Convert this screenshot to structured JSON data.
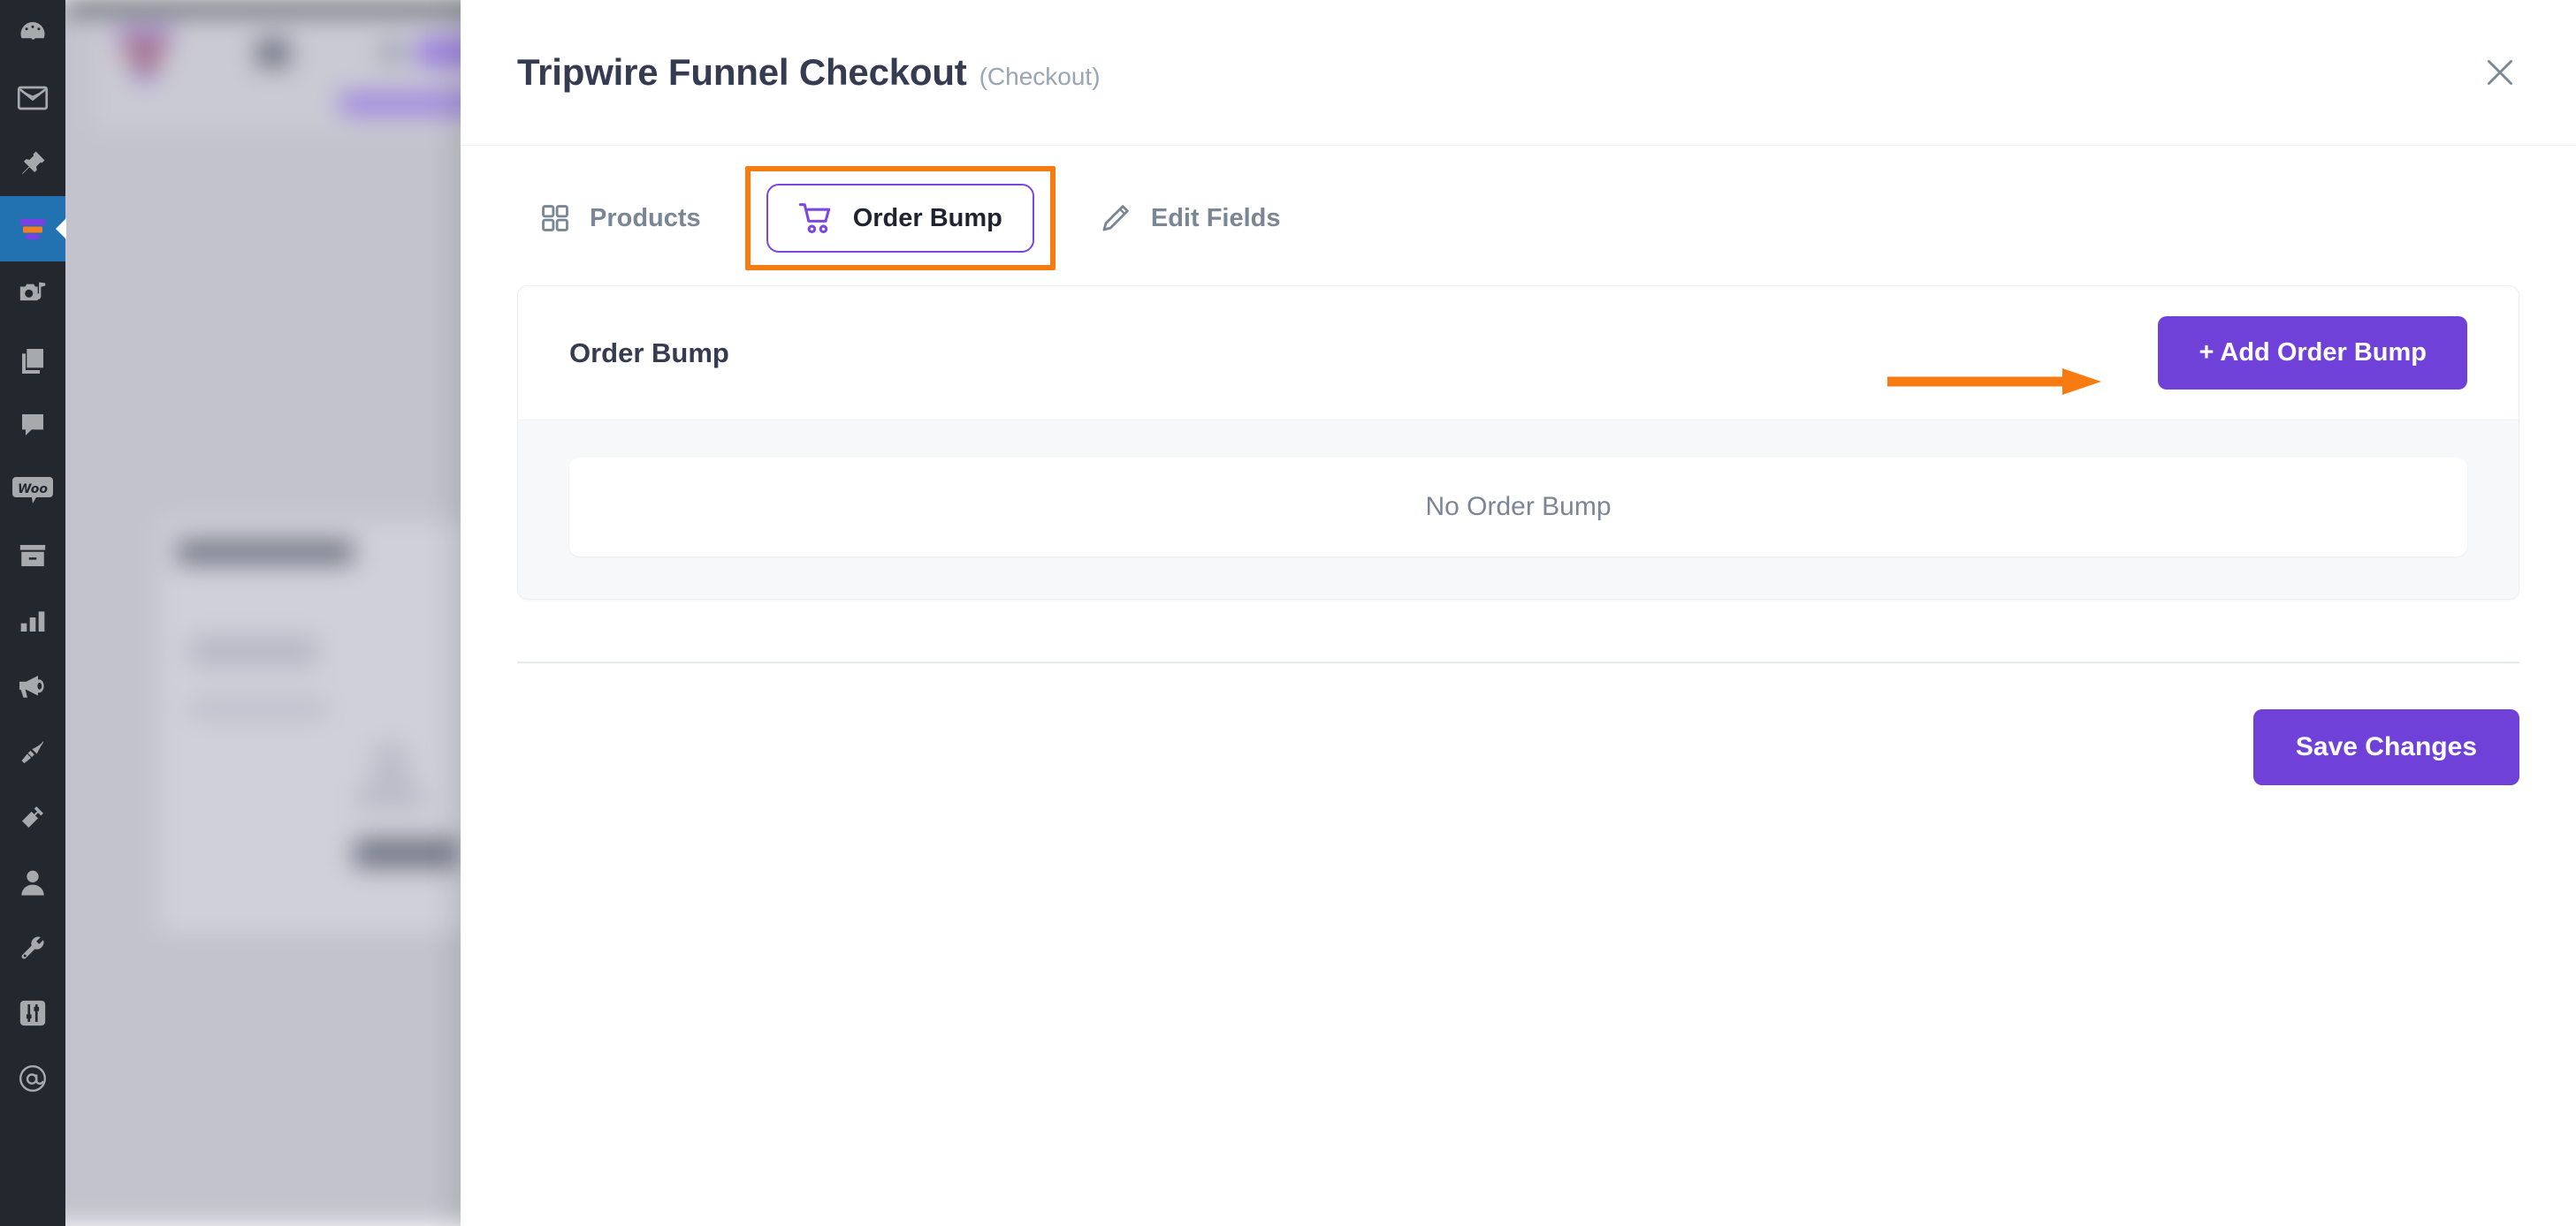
{
  "colors": {
    "accent_purple": "#6f41d8",
    "tab_active_border": "#7b46e3",
    "annotation_orange": "#f77b10",
    "rail_bg": "#23272e",
    "rail_active_bg": "#2271b1",
    "title_text": "#353b50",
    "muted_text": "#7b8694",
    "card_body_bg": "#f7f8fa"
  },
  "sidebar": {
    "items": [
      {
        "name": "dashboard-icon",
        "label": "Dashboard",
        "active": false
      },
      {
        "name": "email-icon",
        "label": "Email",
        "active": false
      },
      {
        "name": "pin-icon",
        "label": "Pin",
        "active": false
      },
      {
        "name": "funnel-icon",
        "label": "Funnels",
        "active": true
      },
      {
        "name": "camera-music-icon",
        "label": "Media",
        "active": false
      },
      {
        "name": "copy-pages-icon",
        "label": "Pages",
        "active": false
      },
      {
        "name": "chat-bubble-icon",
        "label": "Comments",
        "active": false
      },
      {
        "name": "woo-icon",
        "label": "WooCommerce",
        "active": false,
        "glyph": "Woo"
      },
      {
        "name": "archive-box-icon",
        "label": "Archive",
        "active": false
      },
      {
        "name": "bar-chart-icon",
        "label": "Analytics",
        "active": false
      },
      {
        "name": "megaphone-icon",
        "label": "Marketing",
        "active": false
      },
      {
        "name": "paintbrush-icon",
        "label": "Appearance",
        "active": false
      },
      {
        "name": "plug-icon",
        "label": "Plugins",
        "active": false
      },
      {
        "name": "user-icon",
        "label": "Users",
        "active": false
      },
      {
        "name": "wrench-icon",
        "label": "Tools",
        "active": false
      },
      {
        "name": "sliders-icon",
        "label": "Settings",
        "active": false
      },
      {
        "name": "at-sign-icon",
        "label": "Mail",
        "active": false
      }
    ]
  },
  "modal": {
    "title": "Tripwire Funnel Checkout",
    "subtitle": "(Checkout)",
    "close_label": "Close",
    "tabs": [
      {
        "id": "products",
        "label": "Products",
        "icon": "grid-icon",
        "active": false
      },
      {
        "id": "order-bump",
        "label": "Order Bump",
        "icon": "cart-icon",
        "active": true,
        "highlighted": true
      },
      {
        "id": "edit-fields",
        "label": "Edit Fields",
        "icon": "pencil-icon",
        "active": false
      }
    ],
    "order_bump_card": {
      "title": "Order Bump",
      "add_button_label": "+ Add Order Bump",
      "empty_state_text": "No Order Bump"
    },
    "footer": {
      "save_label": "Save Changes"
    }
  },
  "annotations": {
    "arrow_target": "add-order-bump-button",
    "highlight_target": "tab-order-bump"
  }
}
